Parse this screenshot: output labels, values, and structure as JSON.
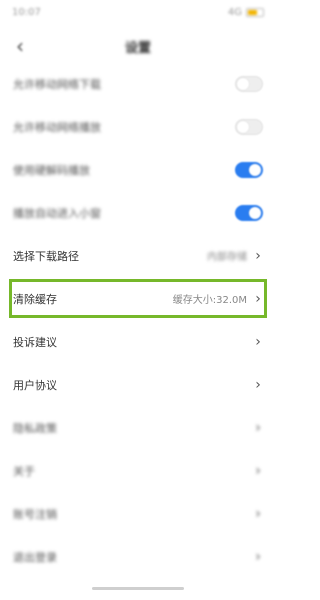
{
  "status": {
    "time": "10:07",
    "signal": "4G"
  },
  "nav": {
    "back_icon": "‹",
    "title": "设置"
  },
  "rows": {
    "r1": {
      "label": "允许移动网络下载",
      "toggle": "off"
    },
    "r2": {
      "label": "允许移动网络播放",
      "toggle": "off"
    },
    "r3": {
      "label": "使用硬解码播放",
      "toggle": "on"
    },
    "r4": {
      "label": "播放自动进入小窗",
      "toggle": "on"
    },
    "r5": {
      "label": "选择下载路径",
      "value": "内部存储"
    },
    "r6": {
      "label": "清除缓存",
      "value": "缓存大小:32.0M"
    },
    "r7": {
      "label": "投诉建议"
    },
    "r8": {
      "label": "用户协议"
    },
    "r9": {
      "label": "隐私政策"
    },
    "r10": {
      "label": "关于"
    },
    "r11": {
      "label": "账号注销"
    },
    "r12": {
      "label": "退出登录"
    }
  },
  "chevron": "›",
  "colors": {
    "toggle_on": "#2a7df0",
    "highlight": "#76b82a"
  }
}
